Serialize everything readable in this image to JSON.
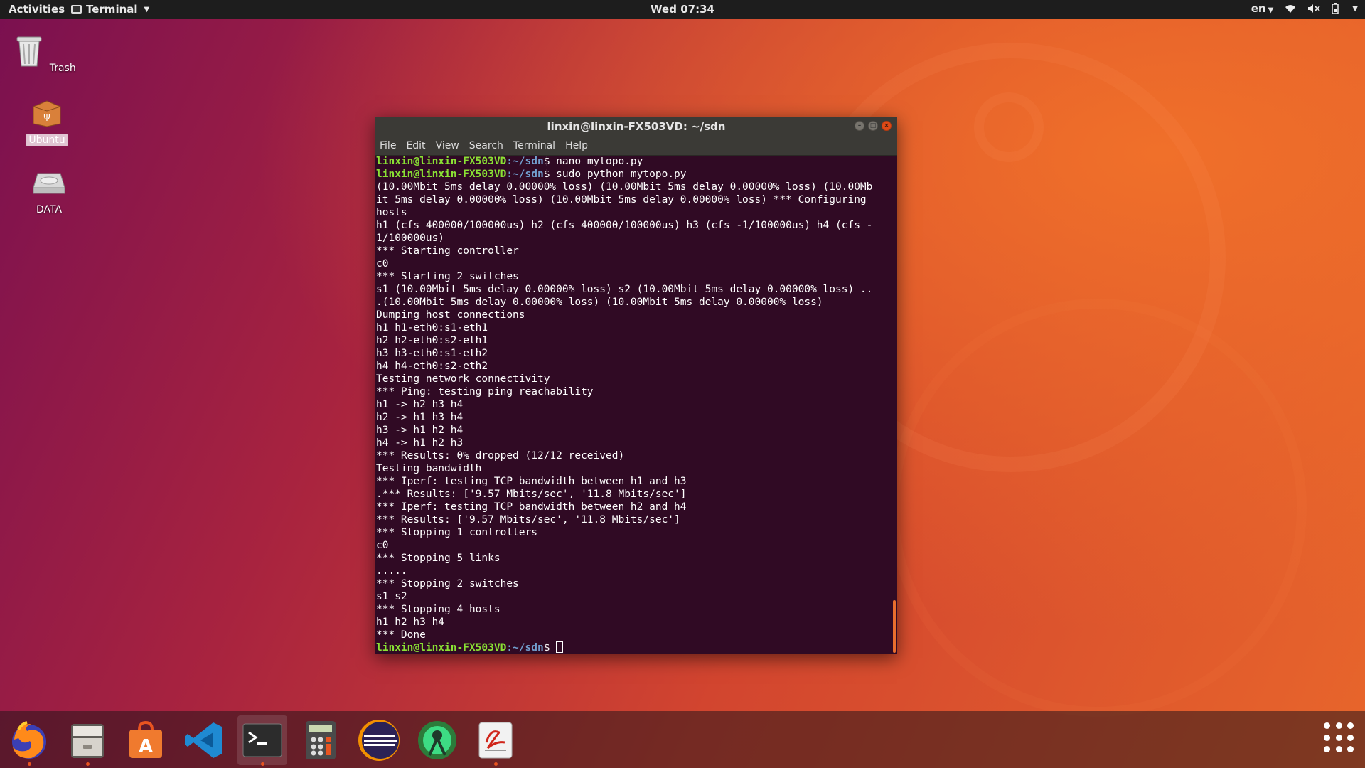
{
  "topbar": {
    "activities": "Activities",
    "app_name": "Terminal",
    "clock": "Wed 07:34",
    "lang": "en"
  },
  "desktop": {
    "icons": [
      {
        "label": "Trash",
        "icon": "trash-icon"
      },
      {
        "label": "Ubuntu",
        "icon": "drive-icon"
      },
      {
        "label": "DATA",
        "icon": "disk-icon"
      }
    ]
  },
  "terminal": {
    "title": "linxin@linxin-FX503VD: ~/sdn",
    "menu": [
      "File",
      "Edit",
      "View",
      "Search",
      "Terminal",
      "Help"
    ],
    "prompt_user": "linxin@linxin-FX503VD",
    "prompt_path": ":~/sdn",
    "lines": [
      {
        "prompt": true,
        "cmd": "$ nano mytopo.py"
      },
      {
        "prompt": true,
        "cmd": "$ sudo python mytopo.py"
      },
      {
        "text": "(10.00Mbit 5ms delay 0.00000% loss) (10.00Mbit 5ms delay 0.00000% loss) (10.00Mb"
      },
      {
        "text": "it 5ms delay 0.00000% loss) (10.00Mbit 5ms delay 0.00000% loss) *** Configuring"
      },
      {
        "text": "hosts"
      },
      {
        "text": "h1 (cfs 400000/100000us) h2 (cfs 400000/100000us) h3 (cfs -1/100000us) h4 (cfs -"
      },
      {
        "text": "1/100000us)"
      },
      {
        "text": "*** Starting controller"
      },
      {
        "text": "c0"
      },
      {
        "text": "*** Starting 2 switches"
      },
      {
        "text": "s1 (10.00Mbit 5ms delay 0.00000% loss) s2 (10.00Mbit 5ms delay 0.00000% loss) .."
      },
      {
        "text": ".(10.00Mbit 5ms delay 0.00000% loss) (10.00Mbit 5ms delay 0.00000% loss)"
      },
      {
        "text": "Dumping host connections"
      },
      {
        "text": "h1 h1-eth0:s1-eth1"
      },
      {
        "text": "h2 h2-eth0:s2-eth1"
      },
      {
        "text": "h3 h3-eth0:s1-eth2"
      },
      {
        "text": "h4 h4-eth0:s2-eth2"
      },
      {
        "text": "Testing network connectivity"
      },
      {
        "text": "*** Ping: testing ping reachability"
      },
      {
        "text": "h1 -> h2 h3 h4"
      },
      {
        "text": "h2 -> h1 h3 h4"
      },
      {
        "text": "h3 -> h1 h2 h4"
      },
      {
        "text": "h4 -> h1 h2 h3"
      },
      {
        "text": "*** Results: 0% dropped (12/12 received)"
      },
      {
        "text": "Testing bandwidth"
      },
      {
        "text": "*** Iperf: testing TCP bandwidth between h1 and h3"
      },
      {
        "text": ".*** Results: ['9.57 Mbits/sec', '11.8 Mbits/sec']"
      },
      {
        "text": "*** Iperf: testing TCP bandwidth between h2 and h4"
      },
      {
        "text": "*** Results: ['9.57 Mbits/sec', '11.8 Mbits/sec']"
      },
      {
        "text": "*** Stopping 1 controllers"
      },
      {
        "text": "c0"
      },
      {
        "text": "*** Stopping 5 links"
      },
      {
        "text": "....."
      },
      {
        "text": "*** Stopping 2 switches"
      },
      {
        "text": "s1 s2"
      },
      {
        "text": "*** Stopping 4 hosts"
      },
      {
        "text": "h1 h2 h3 h4"
      },
      {
        "text": "*** Done"
      },
      {
        "prompt": true,
        "cmd": "$ ",
        "cursor": true
      }
    ]
  },
  "dock": {
    "items": [
      {
        "name": "firefox",
        "running": true
      },
      {
        "name": "files",
        "running": true
      },
      {
        "name": "software-center",
        "running": false
      },
      {
        "name": "vscode",
        "running": false
      },
      {
        "name": "terminal",
        "running": true,
        "active": true
      },
      {
        "name": "calculator",
        "running": false
      },
      {
        "name": "eclipse",
        "running": false
      },
      {
        "name": "android-studio",
        "running": false
      },
      {
        "name": "text-editor",
        "running": true
      }
    ]
  },
  "colors": {
    "terminal_bg": "#300a24",
    "prompt_user": "#8ae234",
    "prompt_path": "#729fcf",
    "accent": "#e95420"
  }
}
